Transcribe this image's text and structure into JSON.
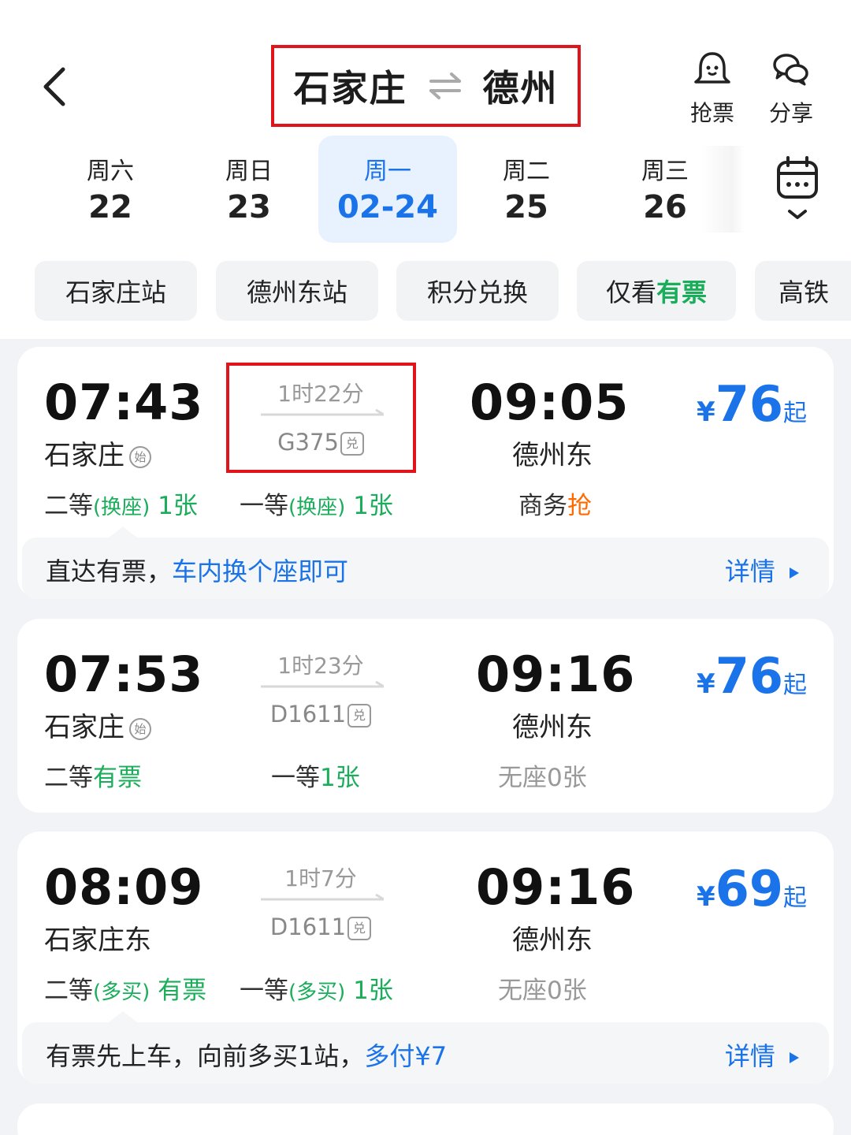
{
  "header": {
    "from": "石家庄",
    "to": "德州",
    "grab_label": "抢票",
    "share_label": "分享"
  },
  "dates": [
    {
      "weekday": "周六",
      "day": "22"
    },
    {
      "weekday": "周日",
      "day": "23"
    },
    {
      "weekday": "周一",
      "day": "02-24",
      "active": true
    },
    {
      "weekday": "周二",
      "day": "25"
    },
    {
      "weekday": "周三",
      "day": "26"
    }
  ],
  "filters": [
    "石家庄站",
    "德州东站",
    "积分兑换",
    "仅看",
    "有票",
    "高铁"
  ],
  "trains": [
    {
      "dep_time": "07:43",
      "dep_station": "石家庄",
      "dep_tag": "始",
      "duration": "1时22分",
      "train_no": "G375",
      "train_tag": "兑",
      "arr_time": "09:05",
      "arr_station": "德州东",
      "price_symbol": "¥",
      "price": "76",
      "price_suffix": "起",
      "seats": {
        "s1_class": "二等",
        "s1_note": "(换座)",
        "s1_avail": "1张",
        "s2_class": "一等",
        "s2_note": "(换座)",
        "s2_avail": "1张",
        "s3_class": "商务",
        "s3_avail": "抢"
      },
      "hint_text": "直达有票，",
      "hint_link": "车内换个座即可",
      "detail_label": "详情"
    },
    {
      "dep_time": "07:53",
      "dep_station": "石家庄",
      "dep_tag": "始",
      "duration": "1时23分",
      "train_no": "D1611",
      "train_tag": "兑",
      "arr_time": "09:16",
      "arr_station": "德州东",
      "price_symbol": "¥",
      "price": "76",
      "price_suffix": "起",
      "seats": {
        "s1_class": "二等",
        "s1_avail": "有票",
        "s2_class": "一等",
        "s2_avail": "1张",
        "s3_text": "无座0张"
      }
    },
    {
      "dep_time": "08:09",
      "dep_station": "石家庄东",
      "duration": "1时7分",
      "train_no": "D1611",
      "train_tag": "兑",
      "arr_time": "09:16",
      "arr_station": "德州东",
      "price_symbol": "¥",
      "price": "69",
      "price_suffix": "起",
      "seats": {
        "s1_class": "二等",
        "s1_note": "(多买)",
        "s1_avail": "有票",
        "s2_class": "一等",
        "s2_note": "(多买)",
        "s2_avail": "1张",
        "s3_text": "无座0张"
      },
      "hint_text": "有票先上车，向前多买1站，",
      "hint_link": "多付¥7",
      "detail_label": "详情"
    }
  ],
  "colors": {
    "accent_blue": "#1a73e8",
    "available_green": "#1aad5a",
    "grab_orange": "#ff6a00",
    "highlight_red": "#e0151b"
  }
}
